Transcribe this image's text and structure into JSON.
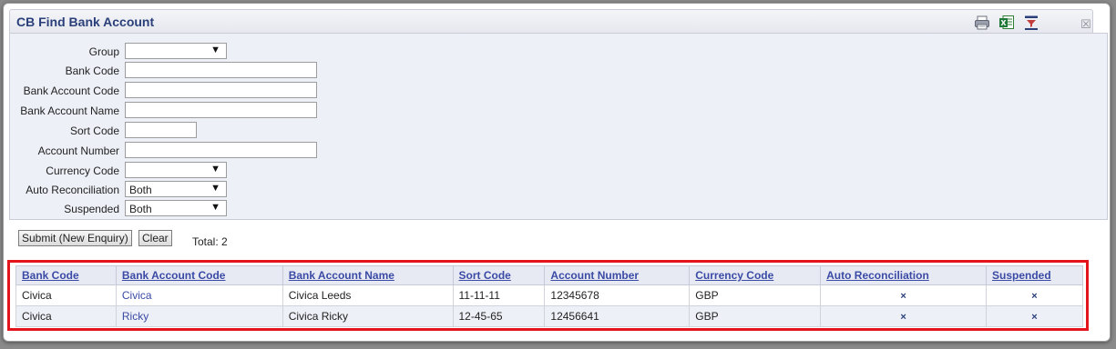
{
  "window": {
    "title": "CB Find Bank Account",
    "close_glyph": "☒",
    "toolbar_icons": [
      "print-icon",
      "excel-export-icon",
      "filter-icon"
    ]
  },
  "form": {
    "fields": [
      {
        "label": "Group",
        "type": "select",
        "value": ""
      },
      {
        "label": "Bank Code",
        "type": "text",
        "value": ""
      },
      {
        "label": "Bank Account Code",
        "type": "text",
        "value": ""
      },
      {
        "label": "Bank Account Name",
        "type": "text",
        "value": ""
      },
      {
        "label": "Sort Code",
        "type": "text",
        "value": ""
      },
      {
        "label": "Account Number",
        "type": "text",
        "value": ""
      },
      {
        "label": "Currency Code",
        "type": "select",
        "value": ""
      },
      {
        "label": "Auto Reconciliation",
        "type": "select",
        "value": "Both"
      },
      {
        "label": "Suspended",
        "type": "select",
        "value": "Both"
      }
    ],
    "select_arrow": "▼"
  },
  "actions": {
    "submit_label": "Submit (New Enquiry)",
    "clear_label": "Clear",
    "total_text": "Total: 2"
  },
  "results": {
    "headers": [
      "Bank Code",
      "Bank Account Code",
      "Bank Account Name",
      "Sort Code",
      "Account Number",
      "Currency Code",
      "Auto Reconciliation",
      "Suspended"
    ],
    "rows": [
      {
        "bank_code": "Civica",
        "bank_account_code": "Civica",
        "bank_account_name": "Civica Leeds",
        "sort_code": "11-11-11",
        "account_number": "12345678",
        "currency_code": "GBP",
        "auto_reconciliation": "×",
        "suspended": "×"
      },
      {
        "bank_code": "Civica",
        "bank_account_code": "Ricky",
        "bank_account_name": "Civica Ricky",
        "sort_code": "12-45-65",
        "account_number": "12456641",
        "currency_code": "GBP",
        "auto_reconciliation": "×",
        "suspended": "×"
      }
    ]
  },
  "colors": {
    "title_text": "#2a3f7a",
    "link": "#3a4aa5",
    "highlight_border": "#e3141c",
    "panel_bg": "#eef0f7"
  }
}
